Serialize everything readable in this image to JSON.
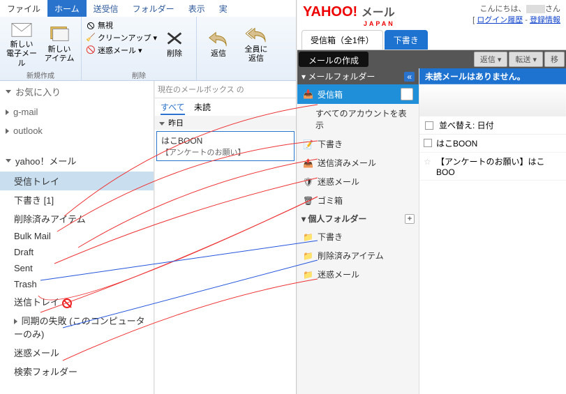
{
  "outlook": {
    "tabs": {
      "file": "ファイル",
      "home": "ホーム",
      "sendrecv": "送受信",
      "folder": "フォルダー",
      "view": "表示",
      "extra": "実"
    },
    "ribbon": {
      "new_mail": "新しい\n電子メール",
      "new_item": "新しい\nアイテム",
      "new_group": "新規作成",
      "ignore": "無視",
      "cleanup": "クリーンアップ",
      "junk": "迷惑メール",
      "delete": "削除",
      "delete_group": "削除",
      "reply": "返信",
      "reply_all": "全員に\n返信"
    },
    "nav": {
      "fav": "お気に入り",
      "gmail": "g-mail",
      "outlook": "outlook",
      "yahoo_acct": "yahoo！メール",
      "folders": {
        "inbox": "受信トレイ",
        "drafts": "下書き [1]",
        "deleted": "削除済みアイテム",
        "bulk": "Bulk Mail",
        "draft_en": "Draft",
        "sent": "Sent",
        "trash": "Trash",
        "outbox": "送信トレイ",
        "sync_fail": "同期の失敗 (このコンピューターのみ)",
        "junk": "迷惑メール",
        "search": "検索フォルダー"
      }
    },
    "list": {
      "search_ph": "現在のメールボックス の",
      "all": "すべて",
      "unread": "未読",
      "day": "昨日",
      "msg_from": "はこBOON",
      "msg_subj": "【アンケートのお願い】"
    }
  },
  "yahoo": {
    "brand": "YAHOO!",
    "brand_jp": "JAPAN",
    "mail_word": "メール",
    "greeting_pre": "こんにちは、",
    "greeting_suf": "さん",
    "link_history": "ログイン履歴",
    "link_reg": "登録情報",
    "tab_inbox": "受信箱（全1件）",
    "tab_drafts": "下書き",
    "compose": "メールの作成",
    "reply_btn": "返信",
    "forward_btn": "転送",
    "move_btn": "移",
    "folder_head": "メールフォルダー",
    "f_inbox": "受信箱",
    "f_allacct": "すべてのアカウントを表示",
    "f_drafts": "下書き",
    "f_sent": "送信済みメール",
    "f_junk": "迷惑メール",
    "f_trash": "ゴミ箱",
    "personal_head": "個人フォルダー",
    "pf_drafts": "下書き",
    "pf_deleted": "削除済みアイテム",
    "pf_junk": "迷惑メール",
    "unread_bar": "未読メールはありません。",
    "sort_label": "並べ替え: 日付",
    "m1": "はこBOON",
    "m2": "【アンケートのお願い】はこBOO"
  }
}
